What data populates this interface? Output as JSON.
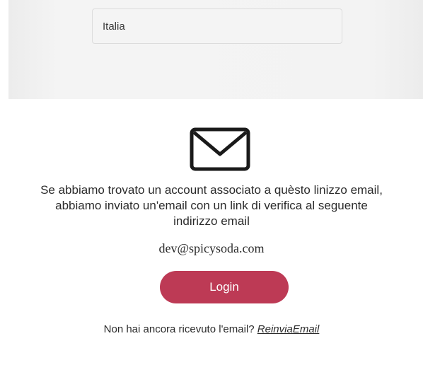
{
  "form": {
    "country_value": "Italia"
  },
  "confirmation": {
    "icon": "mail-icon",
    "message_line1": "Se abbiamo trovato un account associato a quèsto linizzo email,",
    "message_line2": "abbiamo inviato un'email con un link di verifica al seguente",
    "message_line3": "indirizzo email",
    "email": "dev@spicysoda.com",
    "login_label": "Login",
    "resend_prompt": "Non hai ancora ricevuto l'email?",
    "resend_link": "ReinviaEmail"
  },
  "colors": {
    "accent": "#bd3a55",
    "text": "#2b2b2b"
  }
}
